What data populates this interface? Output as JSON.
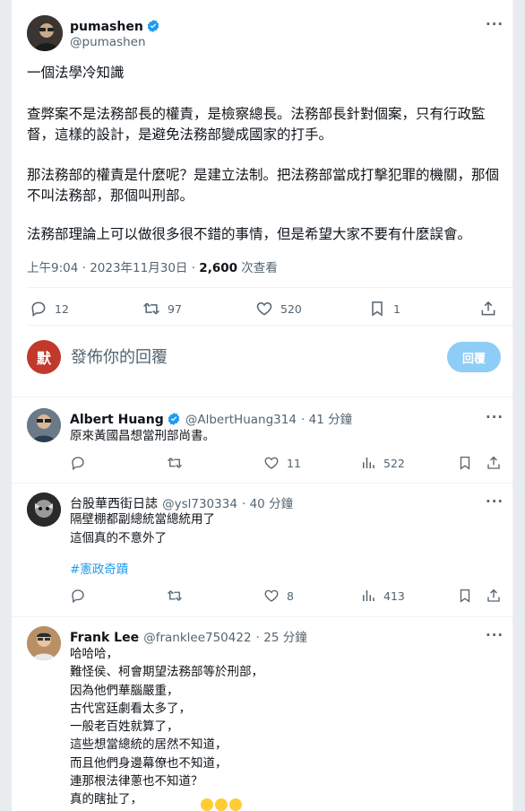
{
  "main_tweet": {
    "name": "pumashen",
    "handle": "@pumashen",
    "paragraphs": [
      "一個法學冷知識",
      "查弊案不是法務部長的權責，是檢察總長。法務部長針對個案，只有行政監督，這樣的設計，是避免法務部變成國家的打手。",
      "那法務部的權責是什麼呢？是建立法制。把法務部當成打擊犯罪的機關，那個不叫法務部，那個叫刑部。",
      "法務部理論上可以做很多很不錯的事情，但是希望大家不要有什麼誤會。"
    ],
    "timestamp": "上午9:04 · 2023年11月30日",
    "views_count": "2,600",
    "views_label": "次查看",
    "replies": "12",
    "retweets": "97",
    "likes": "520",
    "bookmarks": "1"
  },
  "reply_box": {
    "avatar_char": "默",
    "placeholder": "發佈你的回覆",
    "button": "回覆"
  },
  "comments": [
    {
      "name": "Albert Huang",
      "handle": "@AlbertHuang314",
      "time": "41 分鐘",
      "text": "原來黃國昌想當刑部尚書。",
      "likes": "11",
      "views": "522"
    },
    {
      "name": "台股華西街日誌",
      "handle": "@ysl730334",
      "time": "40 分鐘",
      "text": "隔壁棚都副總統當總統用了\n這個真的不意外了",
      "hashtag": "#憲政奇蹟",
      "likes": "8",
      "views": "413"
    },
    {
      "name": "Frank Lee",
      "handle": "@franklee750422",
      "time": "25 分鐘",
      "text": "哈哈哈，\n難怪侯、柯會期望法務部等於刑部，\n因為他們華腦嚴重，\n古代宮廷劇看太多了，\n一般老百姓就算了，\n這些想當總統的居然不知道，\n而且他們身邊幕僚也不知道，\n連那根法律蔥也不知道？\n真的瞎扯了，\n這是民進黨人才濟濟"
    }
  ],
  "colors": {
    "accent": "#1d9bf0",
    "reply_button": "#8ecdf8",
    "muted": "#536471",
    "divider": "#eff3f4"
  }
}
